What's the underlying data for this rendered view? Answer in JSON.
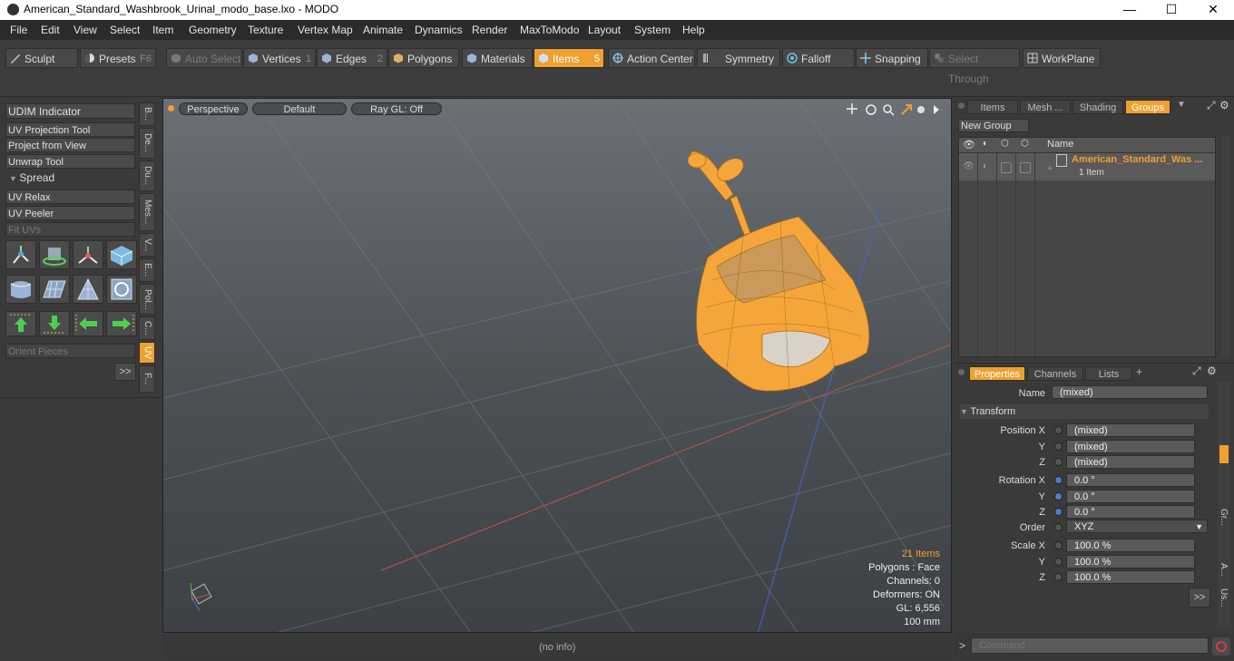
{
  "window": {
    "title": "American_Standard_Washbrook_Urinal_modo_base.lxo - MODO",
    "minimize": "—",
    "maximize": "☐",
    "close": "✕"
  },
  "menu": [
    "File",
    "Edit",
    "View",
    "Select",
    "Item",
    "Geometry",
    "Texture",
    "Vertex Map",
    "Animate",
    "Dynamics",
    "Render",
    "MaxToModo",
    "Layout",
    "System",
    "Help"
  ],
  "toolbar": {
    "sculpt": "Sculpt",
    "presets": "Presets",
    "presets_key": "F6",
    "auto_select": "Auto Select",
    "vertices": "Vertices",
    "vertices_key": "1",
    "edges": "Edges",
    "edges_key": "2",
    "polygons": "Polygons",
    "materials": "Materials",
    "items": "Items",
    "items_key": "5",
    "action_center": "Action Center",
    "symmetry": "Symmetry",
    "falloff": "Falloff",
    "snapping": "Snapping",
    "select_through": "Select Through",
    "workplane": "WorkPlane"
  },
  "left": {
    "buttons": [
      "UDIM Indicator",
      "UV Projection Tool",
      "Project from View",
      "Unwrap Tool"
    ],
    "spread": "Spread",
    "buttons2": [
      "UV Relax",
      "UV Peeler",
      "Fit UVs"
    ],
    "orient": "Orient Pieces",
    "more": ">>",
    "vtabs": [
      "B...",
      "De...",
      "Du...",
      "Mes...",
      "V...",
      "E...",
      "Pol...",
      "C...",
      "UV",
      "F..."
    ]
  },
  "viewport": {
    "perspective": "Perspective",
    "default": "Default",
    "raygl": "Ray GL: Off",
    "stats": [
      "21 Items",
      "Polygons : Face",
      "Channels: 0",
      "Deformers: ON",
      "GL: 6,556",
      "100 mm"
    ]
  },
  "status": {
    "info": "(no info)"
  },
  "groups": {
    "tabs": [
      "Items",
      "Mesh ...",
      "Shading",
      "Groups"
    ],
    "new_group": "New Group",
    "col_name": "Name",
    "item_name": "American_Standard_Was ...",
    "item_count": "1 Item"
  },
  "properties": {
    "tabs": [
      "Properties",
      "Channels",
      "Lists"
    ],
    "add": "+",
    "name_label": "Name",
    "name_value": "(mixed)",
    "transform": "Transform",
    "position_label": "Position X",
    "rotation_label": "Rotation X",
    "scale_label": "Scale X",
    "y": "Y",
    "z": "Z",
    "order_label": "Order",
    "pos": [
      "(mixed)",
      "(mixed)",
      "(mixed)"
    ],
    "rot": [
      "0.0 °",
      "0.0 °",
      "0.0 °"
    ],
    "order": "XYZ",
    "scale": [
      "100.0 %",
      "100.0 %",
      "100.0 %"
    ],
    "more": ">>",
    "side_tabs": [
      "Gr...",
      "A...",
      "Us..."
    ]
  },
  "command": {
    "prompt": ">",
    "placeholder": "Command"
  },
  "colors": {
    "accent": "#f0a030",
    "panel": "#3a3a3a",
    "menubar": "#2b2b2b"
  }
}
